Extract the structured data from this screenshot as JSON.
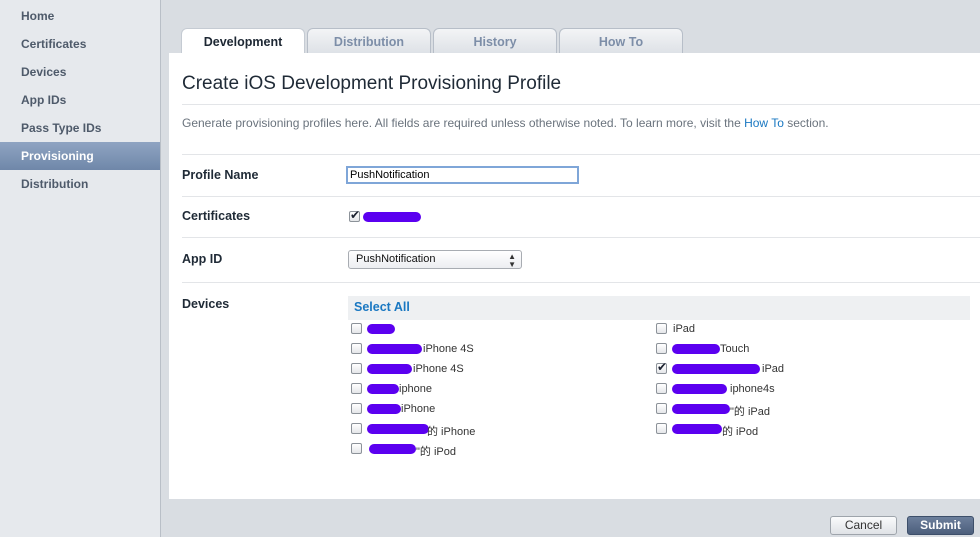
{
  "sidebar": {
    "items": [
      {
        "label": "Home"
      },
      {
        "label": "Certificates"
      },
      {
        "label": "Devices"
      },
      {
        "label": "App IDs"
      },
      {
        "label": "Pass Type IDs"
      },
      {
        "label": "Provisioning",
        "active": true
      },
      {
        "label": "Distribution"
      }
    ]
  },
  "tabs": [
    {
      "label": "Development",
      "active": true
    },
    {
      "label": "Distribution"
    },
    {
      "label": "History"
    },
    {
      "label": "How To"
    }
  ],
  "page": {
    "title": "Create iOS Development Provisioning Profile",
    "intro_text": "Generate provisioning profiles here. All fields are required unless otherwise noted. To learn more, visit the",
    "intro_link": "How To",
    "intro_suffix": "section."
  },
  "form": {
    "profile_name_label": "Profile Name",
    "profile_name_value": "PushNotification",
    "certificates_label": "Certificates",
    "certificate_checked": true,
    "app_id_label": "App ID",
    "app_id_value": "PushNotification",
    "devices_label": "Devices",
    "select_all": "Select All"
  },
  "devices": {
    "left": [
      {
        "label": "",
        "checked": false
      },
      {
        "label": "iPhone 4S",
        "checked": false
      },
      {
        "label": "iPhone 4S",
        "checked": false
      },
      {
        "label": "iphone",
        "checked": false
      },
      {
        "label": "iPhone",
        "checked": false
      },
      {
        "label": "的 iPhone",
        "checked": false
      },
      {
        "label": "\"的 iPod",
        "checked": false
      }
    ],
    "right": [
      {
        "label": "iPad",
        "checked": false
      },
      {
        "label": "Touch",
        "checked": false
      },
      {
        "label": "iPad",
        "checked": true
      },
      {
        "label": "iphone4s",
        "checked": false
      },
      {
        "label": "\"的 iPad",
        "checked": false
      },
      {
        "label": "的 iPod",
        "checked": false
      }
    ]
  },
  "buttons": {
    "cancel": "Cancel",
    "submit": "Submit"
  },
  "colors": {
    "accent_link": "#1a78c2",
    "redaction": "#5b00f0",
    "sidebar_active": "#7a90b0"
  }
}
